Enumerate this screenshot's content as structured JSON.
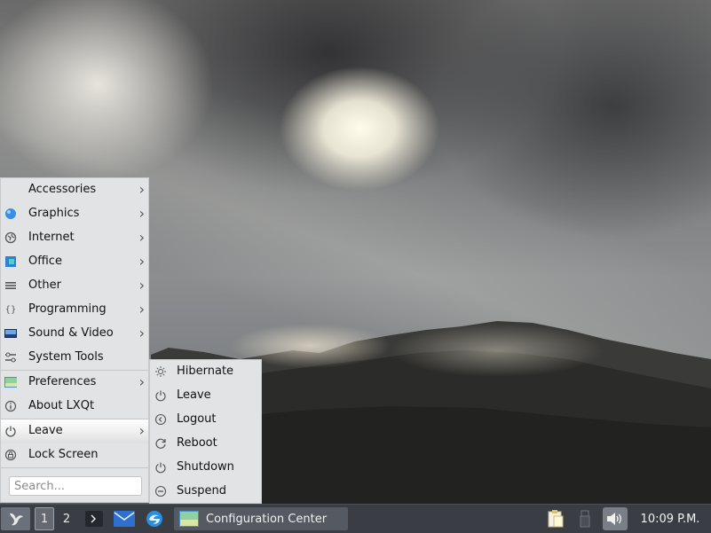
{
  "menu": {
    "items": [
      {
        "label": "Accessories",
        "icon": "accessories-icon",
        "submenu": true
      },
      {
        "label": "Graphics",
        "icon": "graphics-icon",
        "submenu": true
      },
      {
        "label": "Internet",
        "icon": "internet-icon",
        "submenu": true
      },
      {
        "label": "Office",
        "icon": "office-icon",
        "submenu": true
      },
      {
        "label": "Other",
        "icon": "other-icon",
        "submenu": true
      },
      {
        "label": "Programming",
        "icon": "programming-icon",
        "submenu": true
      },
      {
        "label": "Sound & Video",
        "icon": "sound-video-icon",
        "submenu": true
      },
      {
        "label": "System Tools",
        "icon": "system-tools-icon",
        "submenu": true
      },
      {
        "label": "Preferences",
        "icon": "preferences-icon",
        "submenu": true
      },
      {
        "label": "About LXQt",
        "icon": "info-icon",
        "submenu": false
      },
      {
        "label": "Leave",
        "icon": "power-icon",
        "submenu": true,
        "active": true
      },
      {
        "label": "Lock Screen",
        "icon": "lock-icon",
        "submenu": false
      }
    ],
    "search_placeholder": "Search..."
  },
  "leave_submenu": {
    "items": [
      {
        "label": "Hibernate",
        "icon": "hibernate-icon"
      },
      {
        "label": "Leave",
        "icon": "power-icon"
      },
      {
        "label": "Logout",
        "icon": "logout-icon"
      },
      {
        "label": "Reboot",
        "icon": "reboot-icon"
      },
      {
        "label": "Shutdown",
        "icon": "shutdown-icon"
      },
      {
        "label": "Suspend",
        "icon": "suspend-icon"
      }
    ]
  },
  "taskbar": {
    "workspaces": [
      "1",
      "2"
    ],
    "active_workspace": "1",
    "task_label": "Configuration Center",
    "clock": "10:09 P.M."
  },
  "colors": {
    "menu_bg": "#e2e3e4",
    "taskbar_bg": "#3a3e44"
  }
}
